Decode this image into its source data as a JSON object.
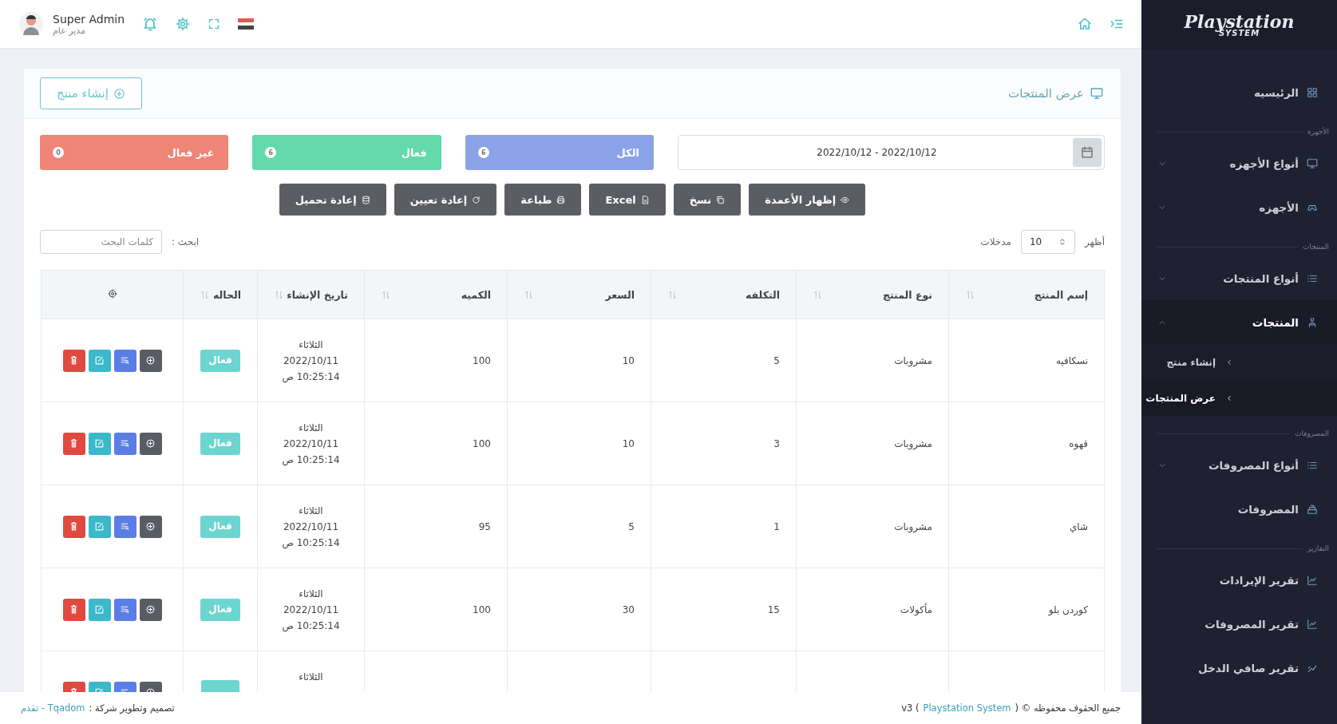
{
  "topbar": {
    "user_name": "Super Admin",
    "user_role": "مدير عام"
  },
  "sidebar": {
    "logo_title": "Playstation",
    "logo_subtitle": "SYSTEM",
    "sections": [
      {
        "items": [
          {
            "label": "الرئيسيه",
            "selected": false
          }
        ]
      },
      {
        "title": "الأجهزه",
        "items": [
          {
            "label": "أنواع الأجهزه",
            "selected": false,
            "expanded": false
          },
          {
            "label": "الأجهزه",
            "selected": false,
            "expanded": false
          }
        ]
      },
      {
        "title": "المنتجات",
        "items": [
          {
            "label": "أنواع المنتجات",
            "selected": false,
            "expanded": false
          },
          {
            "label": "المنتجات",
            "selected": true,
            "expanded": true,
            "children": [
              {
                "label": "إنشاء منتج",
                "selected": false
              },
              {
                "label": "عرض المنتجات",
                "selected": true
              }
            ]
          }
        ]
      },
      {
        "title": "المصروفات",
        "items": [
          {
            "label": "أنواع المصروفات",
            "selected": false,
            "expanded": false
          },
          {
            "label": "المصروفات",
            "selected": false
          }
        ]
      },
      {
        "title": "التقارير",
        "items": [
          {
            "label": "تقرير الإيرادات",
            "selected": false
          },
          {
            "label": "تقرير المصروفات",
            "selected": false
          },
          {
            "label": "تقرير صافي الدخل",
            "selected": false
          }
        ]
      }
    ]
  },
  "page": {
    "title": "عرض المنتجات",
    "create_button": "إنشاء منتج"
  },
  "date_range": "2022/10/12 - 2022/10/12",
  "stats": [
    {
      "label": "الكل",
      "count": "6",
      "color": "#8aa3e6"
    },
    {
      "label": "فعال",
      "count": "6",
      "color": "#63d9ac"
    },
    {
      "label": "غير فعال",
      "count": "0",
      "color": "#ee8576"
    }
  ],
  "toolbar": [
    "إظهار الأعمدة",
    "نسخ",
    "Excel",
    "طباعة",
    "إعادة تعيين",
    "إعادة تحميل"
  ],
  "length": {
    "prefix": "أظهر",
    "value": "10",
    "suffix": "مدخلات"
  },
  "search": {
    "label": "ابحث :",
    "placeholder": "كلمات البحث"
  },
  "table": {
    "columns": [
      "إسم المنتج",
      "نوع المنتج",
      "التكلفه",
      "السعر",
      "الكميه",
      "تاريخ الإنشاء",
      "الحاله"
    ],
    "rows": [
      {
        "name": "نسكافيه",
        "type": "مشروبات",
        "cost": "5",
        "price": "10",
        "qty": "100",
        "day": "الثلاثاء",
        "date": "2022/10/11",
        "time": "10:25:14 ص",
        "status": "فعال",
        "active": true
      },
      {
        "name": "قهوه",
        "type": "مشروبات",
        "cost": "3",
        "price": "10",
        "qty": "100",
        "day": "الثلاثاء",
        "date": "2022/10/11",
        "time": "10:25:14 ص",
        "status": "فعال",
        "active": true
      },
      {
        "name": "شاي",
        "type": "مشروبات",
        "cost": "1",
        "price": "5",
        "qty": "95",
        "day": "الثلاثاء",
        "date": "2022/10/11",
        "time": "10:25:14 ص",
        "status": "فعال",
        "active": true
      },
      {
        "name": "كوردن بلو",
        "type": "مأكولات",
        "cost": "15",
        "price": "30",
        "qty": "100",
        "day": "الثلاثاء",
        "date": "2022/10/11",
        "time": "10:25:14 ص",
        "status": "فعال",
        "active": true
      },
      {
        "day": "الثلاثاء",
        "active": true
      }
    ]
  },
  "footer": {
    "rights": "جميع الحقوف محفوظه © (",
    "brand": "Playstation System",
    "version": ") v3",
    "credit": "تصميم وتطوير شركة :",
    "company": "Tqadom - تقدم"
  }
}
